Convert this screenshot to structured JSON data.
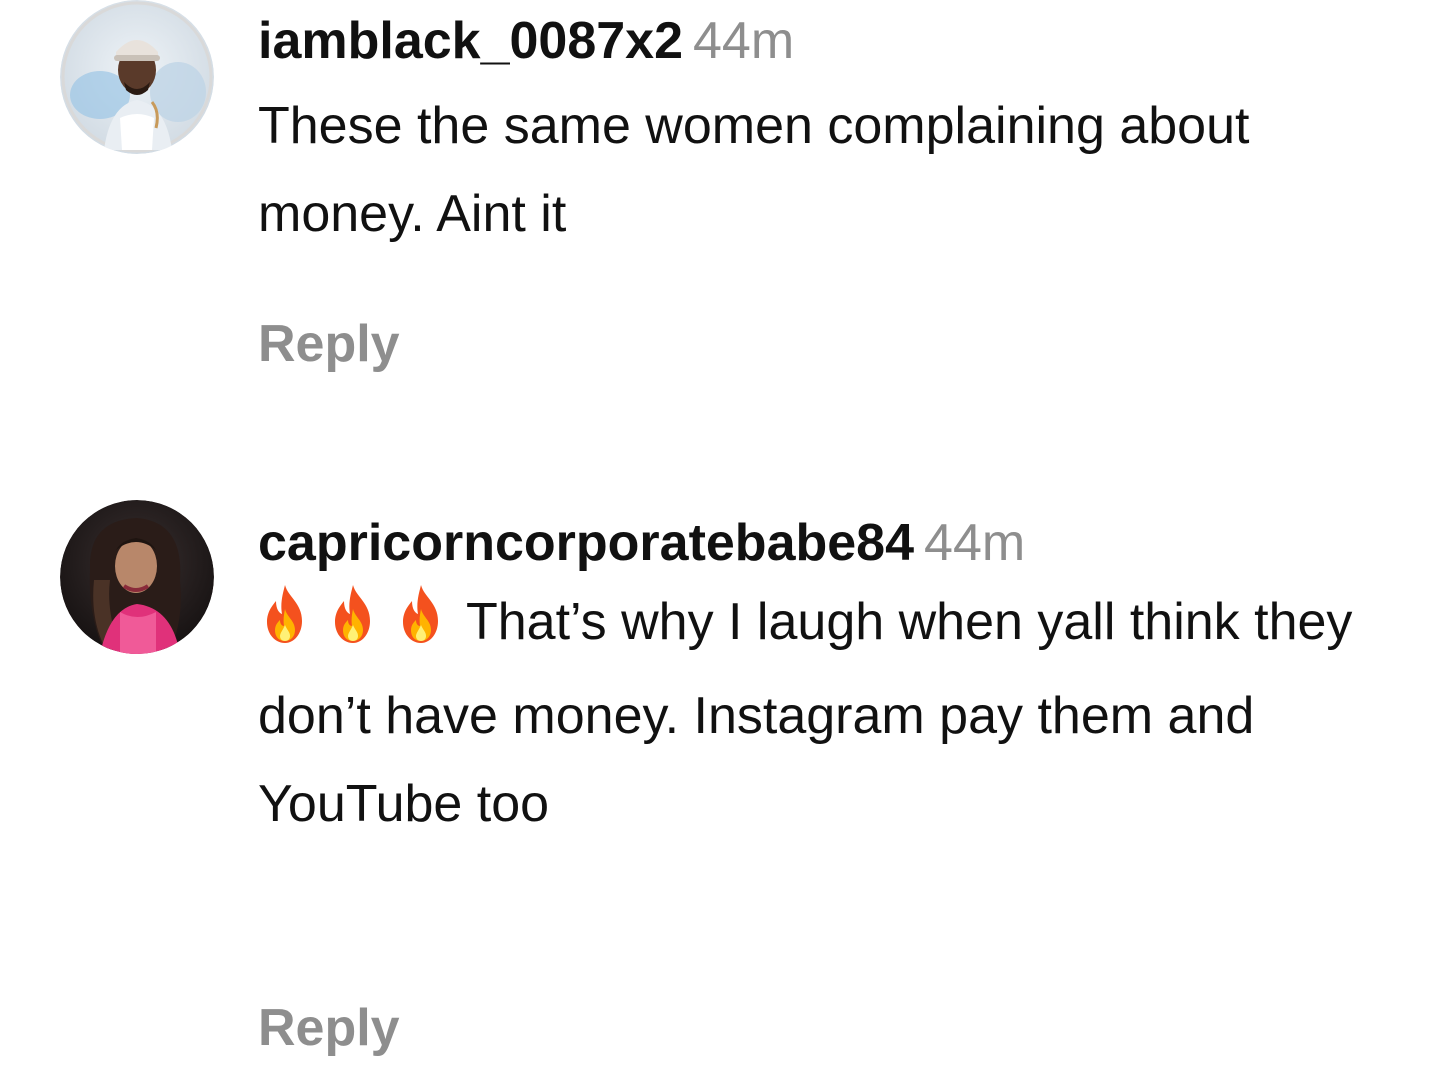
{
  "comments": [
    {
      "username": "iamblack_0087x2",
      "time": "44m",
      "text": "These the same women complaining about money. Aint it",
      "reply_label": "Reply",
      "avatar_icon": "user-avatar"
    },
    {
      "username": "capricorncorporatebabe84",
      "time": "44m",
      "emojis": [
        "fire-icon",
        "fire-icon",
        "fire-icon"
      ],
      "text": "That’s why I laugh when yall think they don’t have money. Instagram pay them and YouTube too",
      "reply_label": "Reply",
      "avatar_icon": "user-avatar"
    }
  ],
  "colors": {
    "text": "#111111",
    "muted": "#8e8e8e",
    "background": "#ffffff"
  }
}
